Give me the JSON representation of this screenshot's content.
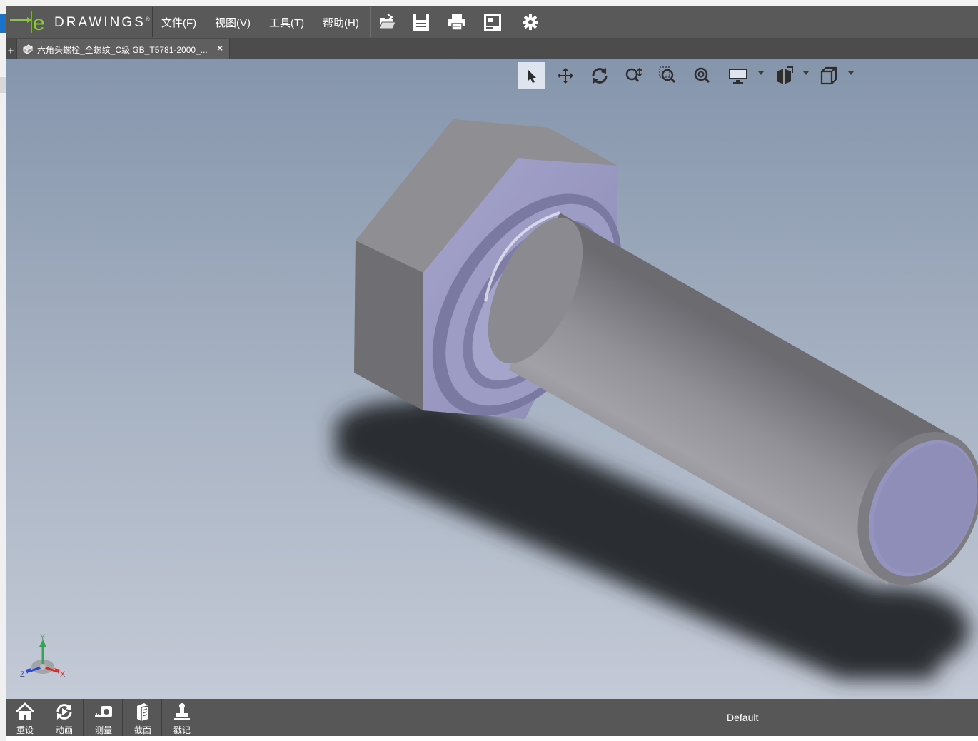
{
  "app": {
    "logo_text": "DRAWINGS",
    "logo_mark": "e",
    "logo_trademark": "®",
    "menus": [
      "文件(F)",
      "视图(V)",
      "工具(T)",
      "帮助(H)"
    ],
    "toolbar_icons": [
      "open-icon",
      "save-icon",
      "print-icon",
      "markup-icon",
      "settings-icon"
    ]
  },
  "tabs": {
    "add_label": "+",
    "items": [
      {
        "label": "六角头螺栓_全螺纹_C级 GB_T5781-2000_...",
        "close": "×",
        "active": true
      }
    ]
  },
  "view_toolbar": {
    "tools": [
      "select-icon",
      "pan-icon",
      "rotate-icon",
      "zoom-icon",
      "zoom-to-area-icon",
      "zoom-to-fit-icon",
      "display-style-icon",
      "views-icon",
      "standard-views-icon"
    ],
    "active_tool": "select-icon"
  },
  "triad": {
    "x": "X",
    "y": "Y",
    "z": "Z"
  },
  "bottom_bar": {
    "buttons": [
      "重设",
      "动画",
      "测量",
      "截面",
      "戳记"
    ],
    "configuration": "Default"
  },
  "colors": {
    "chrome": "#595959",
    "viewport_top": "#8595ac",
    "viewport_bottom": "#c4cad6",
    "logo_accent": "#8cc63f",
    "bolt_steel": "#8d8c92",
    "bolt_face": "#a4a3c9"
  }
}
